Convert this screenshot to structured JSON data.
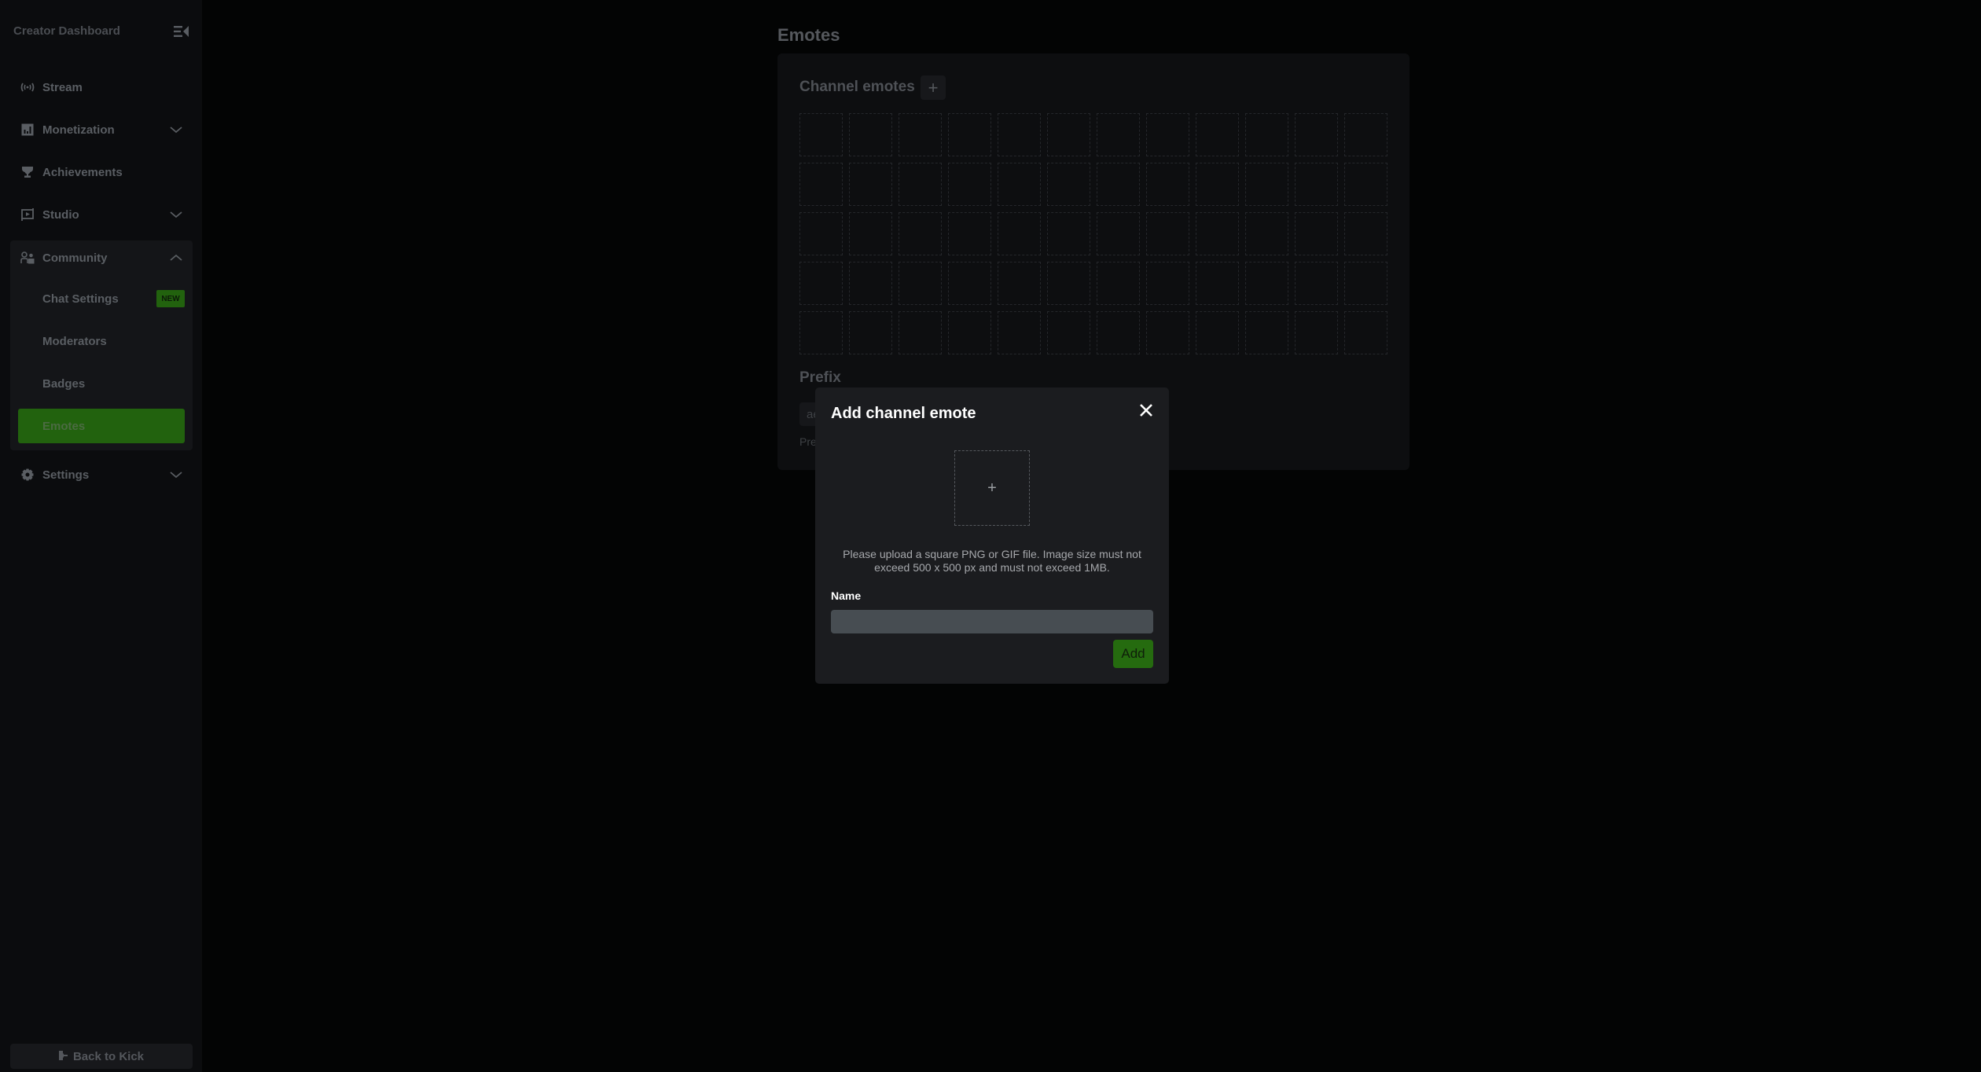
{
  "sidebar": {
    "title": "Creator Dashboard",
    "collapse_icon": "collapse-sidebar-icon",
    "items": [
      {
        "label": "Stream",
        "icon": "broadcast-icon",
        "expandable": false
      },
      {
        "label": "Monetization",
        "icon": "chart-icon",
        "expandable": true
      },
      {
        "label": "Achievements",
        "icon": "trophy-icon",
        "expandable": true
      },
      {
        "label": "Studio",
        "icon": "studio-icon",
        "expandable": true
      }
    ],
    "community": {
      "label": "Community",
      "icon": "community-icon",
      "expanded": true,
      "children": [
        {
          "label": "Chat Settings",
          "badge": "NEW"
        },
        {
          "label": "Moderators"
        },
        {
          "label": "Badges"
        },
        {
          "label": "Emotes",
          "active": true
        }
      ]
    },
    "settings": {
      "label": "Settings",
      "icon": "gear-icon"
    },
    "back_button": "Back to Kick"
  },
  "main": {
    "page_title": "Emotes",
    "channel_emotes": {
      "title": "Channel emotes",
      "add_label": "+",
      "slots_rows": 5,
      "slots_cols": 12
    },
    "prefix": {
      "title": "Prefix",
      "value_visible": "ae",
      "help_visible": "Pre"
    }
  },
  "modal": {
    "title": "Add channel emote",
    "upload_plus": "+",
    "help_text": "Please upload a square PNG or GIF file. Image size must not exceed 500 x 500 px and must not exceed 1MB.",
    "name_label": "Name",
    "name_value": "",
    "add_button": "Add"
  },
  "colors": {
    "accent_green": "#53fc18",
    "active_dimmed": "#22620e"
  }
}
